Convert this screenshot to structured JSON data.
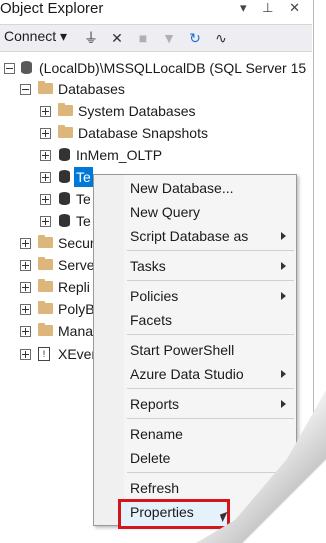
{
  "window": {
    "title": "Object Explorer",
    "pin_glyphs": "▾ ⊥ ✕"
  },
  "toolbar": {
    "connect_label": "Connect ▾"
  },
  "tree": {
    "server": "(LocalDb)\\MSSQLLocalDB (SQL Server 15",
    "databases": "Databases",
    "system_databases": "System Databases",
    "database_snapshots": "Database Snapshots",
    "inmem": "InMem_OLTP",
    "te1": "Te",
    "te2": "Te",
    "te3": "Te",
    "secur": "Secur",
    "serve": "Serve",
    "repli": "Repli",
    "polyb": "PolyB",
    "mana": "Mana",
    "xever": "XEver"
  },
  "context_menu": {
    "new_database": "New Database...",
    "new_query": "New Query",
    "script_database_as": "Script Database as",
    "tasks": "Tasks",
    "policies": "Policies",
    "facets": "Facets",
    "start_powershell": "Start PowerShell",
    "azure_data_studio": "Azure Data Studio",
    "reports": "Reports",
    "rename": "Rename",
    "delete": "Delete",
    "refresh": "Refresh",
    "properties": "Properties"
  }
}
